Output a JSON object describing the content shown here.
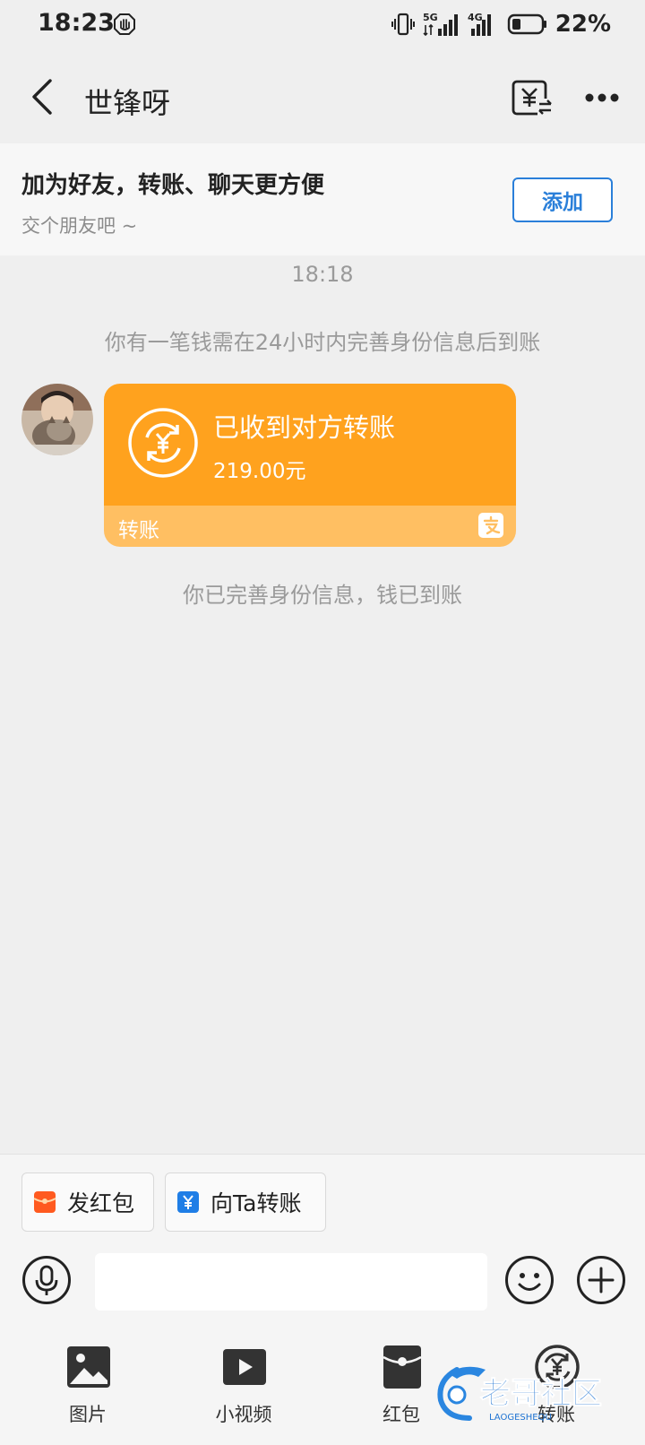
{
  "status_bar": {
    "time": "18:23",
    "network_5g": "5G",
    "network_4g": "4G",
    "battery": "22%"
  },
  "nav": {
    "title": "世锋呀"
  },
  "friend_banner": {
    "title": "加为好友，转账、聊天更方便",
    "subtitle": "交个朋友吧 ~",
    "add_label": "添加"
  },
  "chat": {
    "timestamp": "18:18",
    "system_notice": "你有一笔钱需在24小时内完善身份信息后到账",
    "transfer_card": {
      "title": "已收到对方转账",
      "amount": "219.00元",
      "footer_label": "转账"
    },
    "completion_notice": "你已完善身份信息，钱已到账"
  },
  "quick_actions": [
    {
      "label": "发红包"
    },
    {
      "label": "向Ta转账"
    }
  ],
  "input": {
    "placeholder": ""
  },
  "toolbar": [
    {
      "label": "图片"
    },
    {
      "label": "小视频"
    },
    {
      "label": "红包"
    },
    {
      "label": "转账"
    }
  ],
  "watermark": {
    "text": "老哥社区",
    "subtext": "LAOGESHEQU"
  },
  "colors": {
    "card_orange": "#ffa21e",
    "card_footer": "#ffbf62",
    "accent_blue": "#2a7fd9",
    "redpacket_orange": "#ff5a1f"
  },
  "icons": [
    "hand-icon",
    "vibrate-icon",
    "signal-icon",
    "battery-icon",
    "back-icon",
    "transfer-record-icon",
    "more-icon",
    "coin-transfer-icon",
    "alipay-icon",
    "redpacket-icon",
    "yuan-icon",
    "microphone-icon",
    "emoji-icon",
    "plus-icon",
    "image-icon",
    "video-icon",
    "transfer-icon"
  ]
}
